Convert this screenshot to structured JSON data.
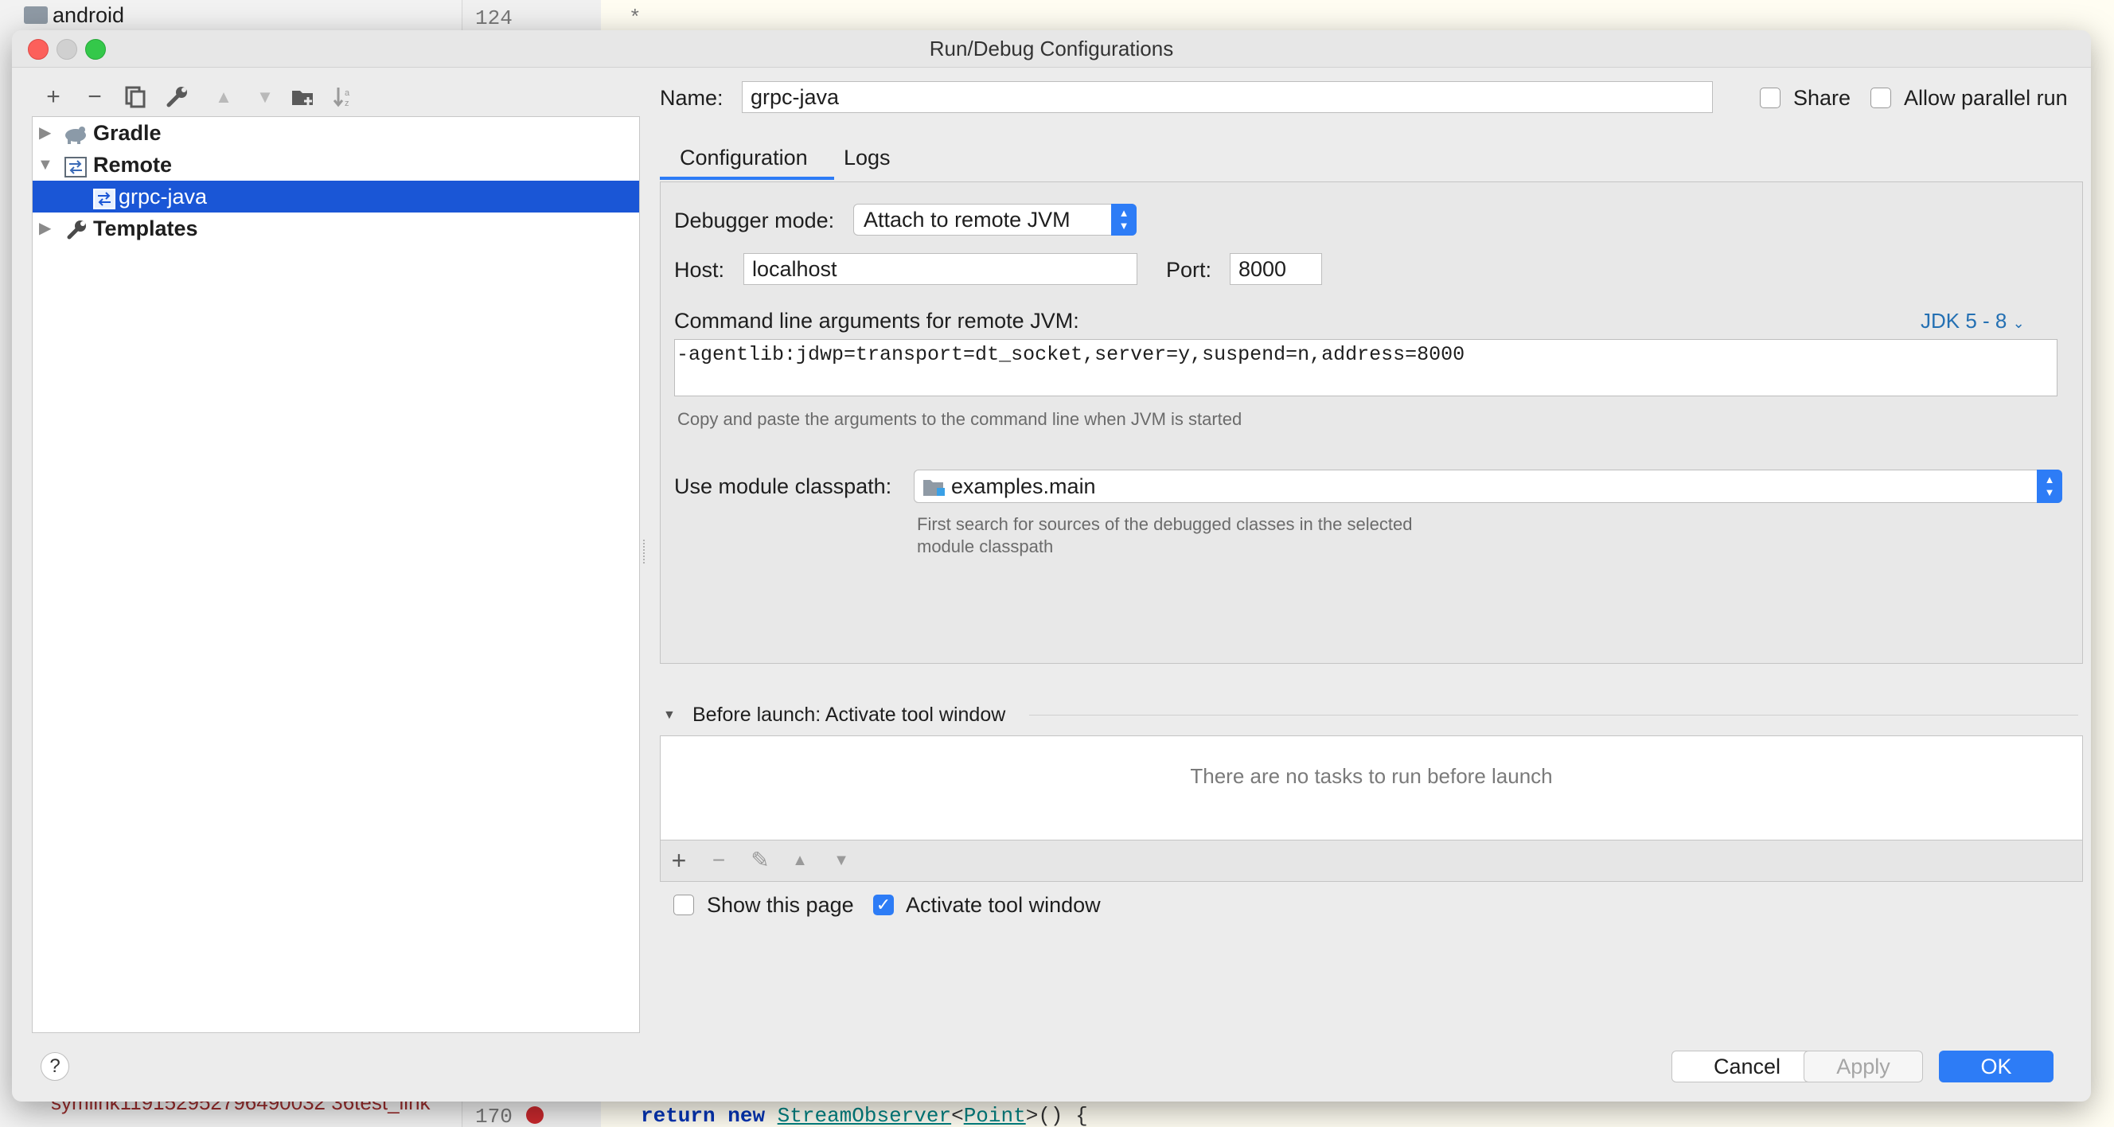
{
  "background": {
    "tree_item": "android",
    "line_numbers": [
      "124",
      "170"
    ],
    "code_top": "*",
    "code_bottom_keyword_return": "return",
    "code_bottom_keyword_new": "new",
    "code_bottom_class": "StreamObserver",
    "code_bottom_generic": "Point",
    "code_bottom_tail": ">() {",
    "bottom_left_item": "symlink119152952796490032 36test_link"
  },
  "dialog": {
    "title": "Run/Debug Configurations",
    "toolbar": {
      "add": "+",
      "remove": "−",
      "copy_icon": "copy-icon",
      "wrench_icon": "wrench-icon",
      "up": "▲",
      "down": "▼",
      "folder_icon": "folder-icon",
      "sort_icon": "sort-icon"
    },
    "tree": [
      {
        "label": "Gradle",
        "expanded": false,
        "icon": "gradle-icon"
      },
      {
        "label": "Remote",
        "expanded": true,
        "icon": "remote-icon"
      },
      {
        "label": "grpc-java",
        "selected": true,
        "icon": "remote-config-icon"
      },
      {
        "label": "Templates",
        "expanded": false,
        "icon": "wrench-icon"
      }
    ],
    "name_label": "Name:",
    "name_value": "grpc-java",
    "share_label": "Share",
    "share_checked": false,
    "parallel_label": "Allow parallel run",
    "parallel_checked": false,
    "tabs": [
      "Configuration",
      "Logs"
    ],
    "active_tab": "Configuration",
    "debugger_mode_label": "Debugger mode:",
    "debugger_mode_value": "Attach to remote JVM",
    "host_label": "Host:",
    "host_value": "localhost",
    "port_label": "Port:",
    "port_value": "8000",
    "cmd_label": "Command line arguments for remote JVM:",
    "jdk_link": "JDK 5 - 8",
    "cmd_value": "-agentlib:jdwp=transport=dt_socket,server=y,suspend=n,address=8000",
    "cmd_hint": "Copy and paste the arguments to the command line when JVM is started",
    "module_label": "Use module classpath:",
    "module_value": "examples.main",
    "module_hint_line1": "First search for sources of the debugged classes in the selected",
    "module_hint_line2": "module classpath",
    "before_launch_label": "Before launch: Activate tool window",
    "no_tasks": "There are no tasks to run before launch",
    "show_page_label": "Show this page",
    "show_page_checked": false,
    "activate_label": "Activate tool window",
    "activate_checked": true,
    "help": "?",
    "cancel": "Cancel",
    "apply": "Apply",
    "ok": "OK"
  },
  "colors": {
    "accent": "#1a56d6",
    "ok_button": "#2d7cf6",
    "link": "#2470b3"
  }
}
